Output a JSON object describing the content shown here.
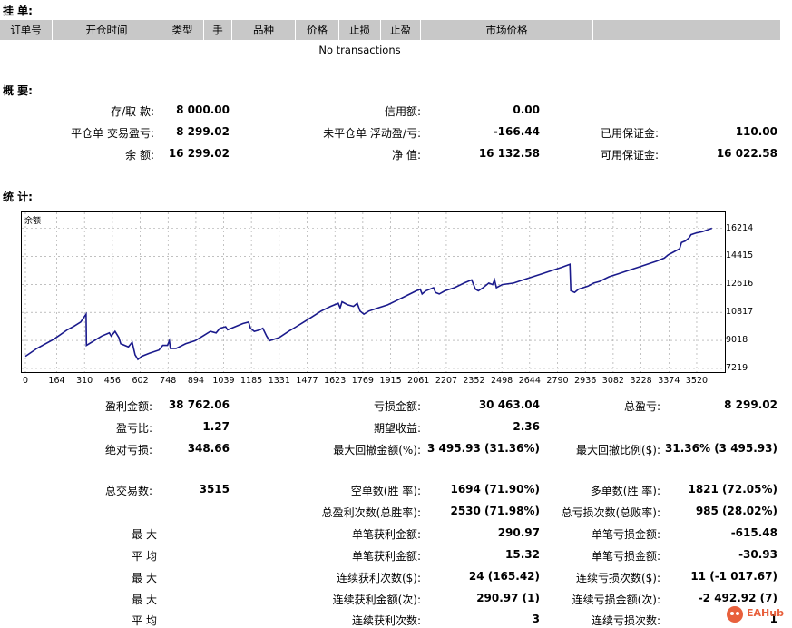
{
  "orders": {
    "title": "挂 单:",
    "columns": [
      "订单号",
      "开仓时间",
      "类型",
      "手",
      "品种",
      "价格",
      "止损",
      "止盈",
      "市场价格",
      ""
    ],
    "empty": "No transactions"
  },
  "summary": {
    "title": "概 要:",
    "deposit_label": "存/取 款:",
    "deposit": "8 000.00",
    "credit_label": "信用额:",
    "credit": "0.00",
    "closed_pl_label": "平仓单 交易盈亏:",
    "closed_pl": "8 299.02",
    "floating_pl_label": "未平仓单 浮动盈/亏:",
    "floating_pl": "-166.44",
    "margin_label": "已用保证金:",
    "margin": "110.00",
    "balance_label": "余 额:",
    "balance": "16 299.02",
    "equity_label": "净 值:",
    "equity": "16 132.58",
    "free_margin_label": "可用保证金:",
    "free_margin": "16 022.58"
  },
  "stats_title": "统 计:",
  "chart_data": {
    "type": "line",
    "legend": "余额",
    "x_ticks": [
      0,
      164,
      310,
      456,
      602,
      748,
      894,
      1039,
      1185,
      1331,
      1477,
      1623,
      1769,
      1915,
      2061,
      2207,
      2352,
      2498,
      2644,
      2790,
      2936,
      3082,
      3228,
      3374,
      3520
    ],
    "y_ticks": [
      16214,
      14415,
      12616,
      10817,
      9018,
      7219
    ],
    "xlim": [
      0,
      3620
    ],
    "ylim": [
      7219,
      17000
    ],
    "series": [
      {
        "points": [
          [
            0,
            8000
          ],
          [
            60,
            8500
          ],
          [
            150,
            9100
          ],
          [
            220,
            9700
          ],
          [
            250,
            9900
          ],
          [
            290,
            10200
          ],
          [
            318,
            10700
          ],
          [
            320,
            8700
          ],
          [
            360,
            9000
          ],
          [
            400,
            9300
          ],
          [
            440,
            9500
          ],
          [
            450,
            9300
          ],
          [
            470,
            9600
          ],
          [
            490,
            9200
          ],
          [
            500,
            8800
          ],
          [
            540,
            8600
          ],
          [
            560,
            8900
          ],
          [
            575,
            8100
          ],
          [
            590,
            7800
          ],
          [
            610,
            8000
          ],
          [
            650,
            8200
          ],
          [
            700,
            8400
          ],
          [
            720,
            8700
          ],
          [
            745,
            8700
          ],
          [
            755,
            9000
          ],
          [
            760,
            8500
          ],
          [
            790,
            8500
          ],
          [
            840,
            8800
          ],
          [
            890,
            9000
          ],
          [
            930,
            9300
          ],
          [
            970,
            9600
          ],
          [
            1000,
            9500
          ],
          [
            1020,
            9800
          ],
          [
            1050,
            9900
          ],
          [
            1060,
            9700
          ],
          [
            1100,
            9900
          ],
          [
            1140,
            10100
          ],
          [
            1170,
            10200
          ],
          [
            1180,
            9800
          ],
          [
            1200,
            9600
          ],
          [
            1230,
            9700
          ],
          [
            1245,
            9800
          ],
          [
            1265,
            9300
          ],
          [
            1280,
            9000
          ],
          [
            1330,
            9200
          ],
          [
            1380,
            9600
          ],
          [
            1420,
            9900
          ],
          [
            1460,
            10200
          ],
          [
            1500,
            10500
          ],
          [
            1550,
            10900
          ],
          [
            1600,
            11200
          ],
          [
            1640,
            11400
          ],
          [
            1650,
            11100
          ],
          [
            1660,
            11500
          ],
          [
            1690,
            11300
          ],
          [
            1720,
            11200
          ],
          [
            1740,
            11400
          ],
          [
            1755,
            10900
          ],
          [
            1775,
            10700
          ],
          [
            1800,
            10900
          ],
          [
            1850,
            11100
          ],
          [
            1900,
            11300
          ],
          [
            1950,
            11600
          ],
          [
            2000,
            11900
          ],
          [
            2050,
            12200
          ],
          [
            2070,
            12300
          ],
          [
            2080,
            12000
          ],
          [
            2100,
            12200
          ],
          [
            2140,
            12400
          ],
          [
            2150,
            12100
          ],
          [
            2170,
            12000
          ],
          [
            2200,
            12200
          ],
          [
            2250,
            12400
          ],
          [
            2300,
            12700
          ],
          [
            2340,
            12900
          ],
          [
            2360,
            12300
          ],
          [
            2375,
            12200
          ],
          [
            2400,
            12400
          ],
          [
            2430,
            12700
          ],
          [
            2450,
            12600
          ],
          [
            2460,
            12900
          ],
          [
            2470,
            12400
          ],
          [
            2500,
            12600
          ],
          [
            2560,
            12700
          ],
          [
            2610,
            12900
          ],
          [
            2660,
            13100
          ],
          [
            2710,
            13300
          ],
          [
            2760,
            13500
          ],
          [
            2810,
            13700
          ],
          [
            2855,
            13900
          ],
          [
            2860,
            12200
          ],
          [
            2880,
            12100
          ],
          [
            2900,
            12300
          ],
          [
            2950,
            12500
          ],
          [
            2980,
            12700
          ],
          [
            3010,
            12800
          ],
          [
            3060,
            13100
          ],
          [
            3110,
            13300
          ],
          [
            3160,
            13500
          ],
          [
            3210,
            13700
          ],
          [
            3260,
            13900
          ],
          [
            3310,
            14100
          ],
          [
            3350,
            14300
          ],
          [
            3370,
            14500
          ],
          [
            3400,
            14700
          ],
          [
            3430,
            14900
          ],
          [
            3440,
            15300
          ],
          [
            3460,
            15400
          ],
          [
            3480,
            15600
          ],
          [
            3490,
            15800
          ],
          [
            3515,
            15900
          ],
          [
            3550,
            16000
          ],
          [
            3600,
            16214
          ]
        ]
      }
    ]
  },
  "stats": {
    "gross_profit_label": "盈利金额:",
    "gross_profit": "38 762.06",
    "gross_loss_label": "亏损金额:",
    "gross_loss": "30 463.04",
    "total_pl_label": "总盈亏:",
    "total_pl": "8 299.02",
    "profit_factor_label": "盈亏比:",
    "profit_factor": "1.27",
    "expected_payoff_label": "期望收益:",
    "expected_payoff": "2.36",
    "abs_dd_label": "绝对亏损:",
    "abs_dd": "348.66",
    "max_dd_label": "最大回撤金额(%):",
    "max_dd": "3 495.93 (31.36%)",
    "max_dd_pct_label": "最大回撤比例($):",
    "max_dd_pct": "31.36% (3 495.93)",
    "total_trades_label": "总交易数:",
    "total_trades": "3515",
    "short_label": "空单数(胜 率):",
    "short": "1694 (71.90%)",
    "long_label": "多单数(胜 率):",
    "long": "1821 (72.05%)",
    "profit_trades_label": "总盈利次数(总胜率):",
    "profit_trades": "2530 (71.98%)",
    "loss_trades_label": "总亏损次数(总败率):",
    "loss_trades": "985 (28.02%)",
    "largest_label": "最 大",
    "largest_profit_label": "单笔获利金额:",
    "largest_profit": "290.97",
    "largest_loss_label": "单笔亏损金额:",
    "largest_loss": "-615.48",
    "average_label": "平 均",
    "avg_profit_label": "单笔获利金额:",
    "avg_profit": "15.32",
    "avg_loss_label": "单笔亏损金额:",
    "avg_loss": "-30.93",
    "max_label": "最 大",
    "max_consec_wins_label": "连续获利次数($):",
    "max_consec_wins": "24 (165.42)",
    "max_consec_losses_label": "连续亏损次数($):",
    "max_consec_losses": "11 (-1 017.67)",
    "max2_label": "最 大",
    "max_consec_profit_label": "连续获利金额(次):",
    "max_consec_profit": "290.97 (1)",
    "max_consec_loss_label": "连续亏损金额(次):",
    "max_consec_loss": "-2 492.92 (7)",
    "avg2_label": "平 均",
    "avg_consec_wins_label": "连续获利次数:",
    "avg_consec_wins": "3",
    "avg_consec_losses_label": "连续亏损次数:",
    "avg_consec_losses": "1"
  },
  "watermark": "EAHub"
}
